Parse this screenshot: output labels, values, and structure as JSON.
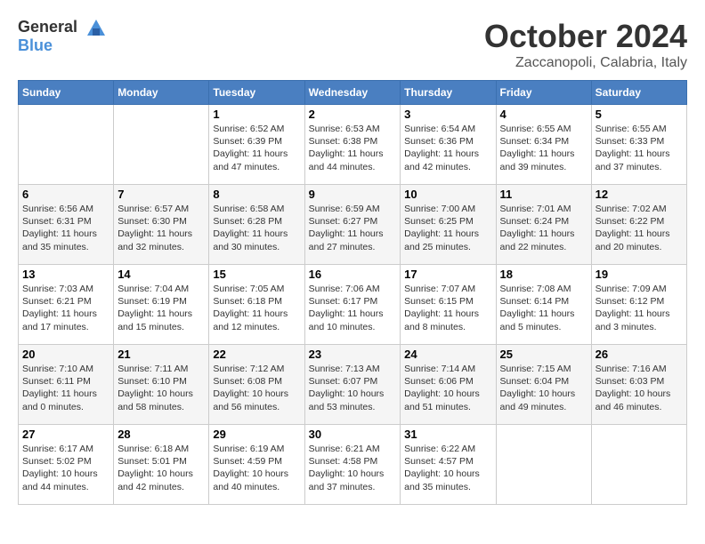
{
  "header": {
    "logo_line1": "General",
    "logo_line2": "Blue",
    "month": "October 2024",
    "location": "Zaccanopoli, Calabria, Italy"
  },
  "days_of_week": [
    "Sunday",
    "Monday",
    "Tuesday",
    "Wednesday",
    "Thursday",
    "Friday",
    "Saturday"
  ],
  "weeks": [
    [
      {
        "day": "",
        "info": ""
      },
      {
        "day": "",
        "info": ""
      },
      {
        "day": "1",
        "info": "Sunrise: 6:52 AM\nSunset: 6:39 PM\nDaylight: 11 hours and 47 minutes."
      },
      {
        "day": "2",
        "info": "Sunrise: 6:53 AM\nSunset: 6:38 PM\nDaylight: 11 hours and 44 minutes."
      },
      {
        "day": "3",
        "info": "Sunrise: 6:54 AM\nSunset: 6:36 PM\nDaylight: 11 hours and 42 minutes."
      },
      {
        "day": "4",
        "info": "Sunrise: 6:55 AM\nSunset: 6:34 PM\nDaylight: 11 hours and 39 minutes."
      },
      {
        "day": "5",
        "info": "Sunrise: 6:55 AM\nSunset: 6:33 PM\nDaylight: 11 hours and 37 minutes."
      }
    ],
    [
      {
        "day": "6",
        "info": "Sunrise: 6:56 AM\nSunset: 6:31 PM\nDaylight: 11 hours and 35 minutes."
      },
      {
        "day": "7",
        "info": "Sunrise: 6:57 AM\nSunset: 6:30 PM\nDaylight: 11 hours and 32 minutes."
      },
      {
        "day": "8",
        "info": "Sunrise: 6:58 AM\nSunset: 6:28 PM\nDaylight: 11 hours and 30 minutes."
      },
      {
        "day": "9",
        "info": "Sunrise: 6:59 AM\nSunset: 6:27 PM\nDaylight: 11 hours and 27 minutes."
      },
      {
        "day": "10",
        "info": "Sunrise: 7:00 AM\nSunset: 6:25 PM\nDaylight: 11 hours and 25 minutes."
      },
      {
        "day": "11",
        "info": "Sunrise: 7:01 AM\nSunset: 6:24 PM\nDaylight: 11 hours and 22 minutes."
      },
      {
        "day": "12",
        "info": "Sunrise: 7:02 AM\nSunset: 6:22 PM\nDaylight: 11 hours and 20 minutes."
      }
    ],
    [
      {
        "day": "13",
        "info": "Sunrise: 7:03 AM\nSunset: 6:21 PM\nDaylight: 11 hours and 17 minutes."
      },
      {
        "day": "14",
        "info": "Sunrise: 7:04 AM\nSunset: 6:19 PM\nDaylight: 11 hours and 15 minutes."
      },
      {
        "day": "15",
        "info": "Sunrise: 7:05 AM\nSunset: 6:18 PM\nDaylight: 11 hours and 12 minutes."
      },
      {
        "day": "16",
        "info": "Sunrise: 7:06 AM\nSunset: 6:17 PM\nDaylight: 11 hours and 10 minutes."
      },
      {
        "day": "17",
        "info": "Sunrise: 7:07 AM\nSunset: 6:15 PM\nDaylight: 11 hours and 8 minutes."
      },
      {
        "day": "18",
        "info": "Sunrise: 7:08 AM\nSunset: 6:14 PM\nDaylight: 11 hours and 5 minutes."
      },
      {
        "day": "19",
        "info": "Sunrise: 7:09 AM\nSunset: 6:12 PM\nDaylight: 11 hours and 3 minutes."
      }
    ],
    [
      {
        "day": "20",
        "info": "Sunrise: 7:10 AM\nSunset: 6:11 PM\nDaylight: 11 hours and 0 minutes."
      },
      {
        "day": "21",
        "info": "Sunrise: 7:11 AM\nSunset: 6:10 PM\nDaylight: 10 hours and 58 minutes."
      },
      {
        "day": "22",
        "info": "Sunrise: 7:12 AM\nSunset: 6:08 PM\nDaylight: 10 hours and 56 minutes."
      },
      {
        "day": "23",
        "info": "Sunrise: 7:13 AM\nSunset: 6:07 PM\nDaylight: 10 hours and 53 minutes."
      },
      {
        "day": "24",
        "info": "Sunrise: 7:14 AM\nSunset: 6:06 PM\nDaylight: 10 hours and 51 minutes."
      },
      {
        "day": "25",
        "info": "Sunrise: 7:15 AM\nSunset: 6:04 PM\nDaylight: 10 hours and 49 minutes."
      },
      {
        "day": "26",
        "info": "Sunrise: 7:16 AM\nSunset: 6:03 PM\nDaylight: 10 hours and 46 minutes."
      }
    ],
    [
      {
        "day": "27",
        "info": "Sunrise: 6:17 AM\nSunset: 5:02 PM\nDaylight: 10 hours and 44 minutes."
      },
      {
        "day": "28",
        "info": "Sunrise: 6:18 AM\nSunset: 5:01 PM\nDaylight: 10 hours and 42 minutes."
      },
      {
        "day": "29",
        "info": "Sunrise: 6:19 AM\nSunset: 4:59 PM\nDaylight: 10 hours and 40 minutes."
      },
      {
        "day": "30",
        "info": "Sunrise: 6:21 AM\nSunset: 4:58 PM\nDaylight: 10 hours and 37 minutes."
      },
      {
        "day": "31",
        "info": "Sunrise: 6:22 AM\nSunset: 4:57 PM\nDaylight: 10 hours and 35 minutes."
      },
      {
        "day": "",
        "info": ""
      },
      {
        "day": "",
        "info": ""
      }
    ]
  ]
}
